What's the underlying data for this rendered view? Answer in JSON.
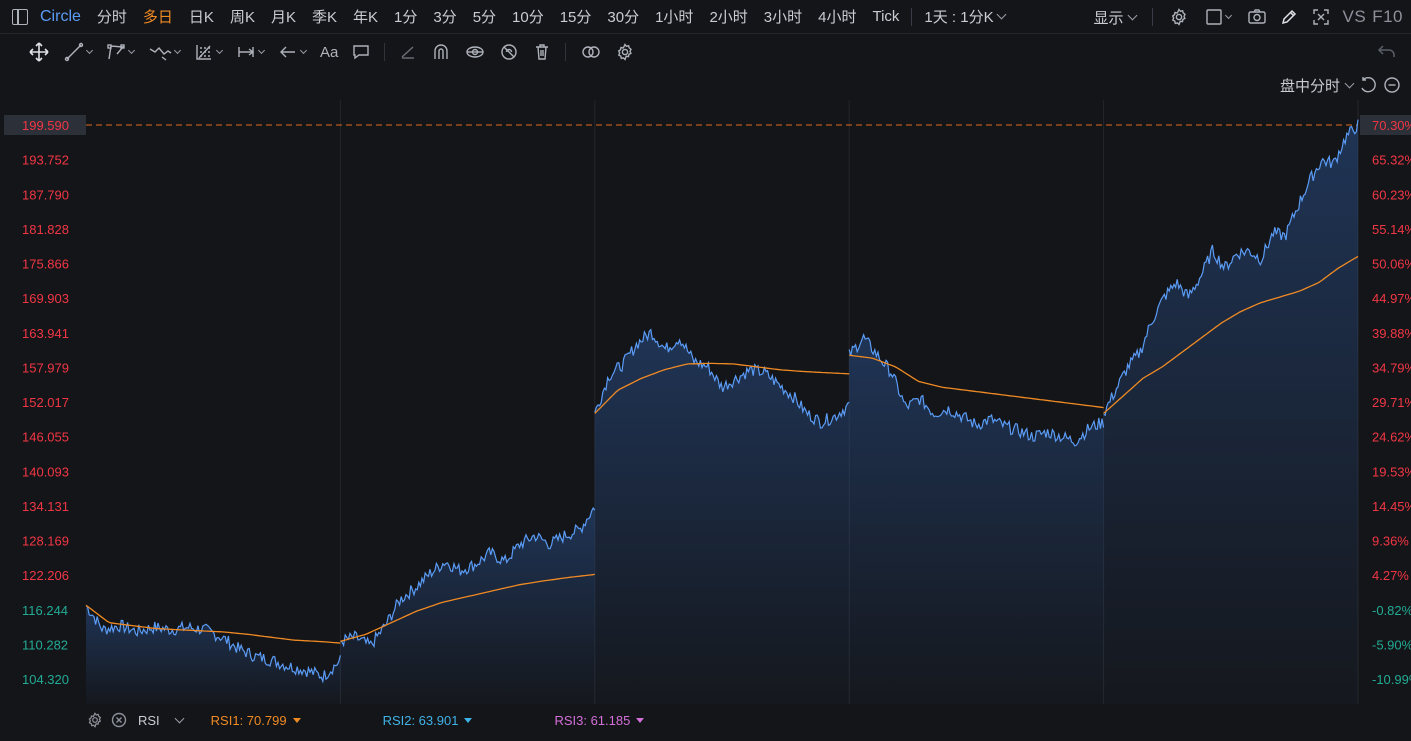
{
  "header": {
    "symbol": "Circle",
    "periods": [
      {
        "label": "分时",
        "active": false
      },
      {
        "label": "多日",
        "active": true
      },
      {
        "label": "日K",
        "active": false
      },
      {
        "label": "周K",
        "active": false
      },
      {
        "label": "月K",
        "active": false
      },
      {
        "label": "季K",
        "active": false
      },
      {
        "label": "年K",
        "active": false
      },
      {
        "label": "1分",
        "active": false
      },
      {
        "label": "3分",
        "active": false
      },
      {
        "label": "5分",
        "active": false
      },
      {
        "label": "10分",
        "active": false
      },
      {
        "label": "15分",
        "active": false
      },
      {
        "label": "30分",
        "active": false
      },
      {
        "label": "1小时",
        "active": false
      },
      {
        "label": "2小时",
        "active": false
      },
      {
        "label": "3小时",
        "active": false
      },
      {
        "label": "4小时",
        "active": false
      },
      {
        "label": "Tick",
        "active": false
      }
    ],
    "range_select": "1天 : 1分K",
    "display_label": "显示",
    "vs_label": "VS",
    "f10_label": "F10"
  },
  "drawing_tools": [
    "move-icon",
    "line-icon",
    "polyline-icon",
    "wave-icon",
    "fib-icon",
    "measure-icon",
    "arrow-icon",
    "text-icon",
    "note-icon",
    "pen-icon",
    "magnet-icon",
    "hide-icon",
    "lock-icon",
    "trash-icon",
    "link-icon",
    "settings-icon"
  ],
  "chart_header": {
    "mode_label": "盘中分时"
  },
  "chart_data": {
    "type": "line",
    "title": "",
    "y_left_ticks": [
      "199.590",
      "193.752",
      "187.790",
      "181.828",
      "175.866",
      "169.903",
      "163.941",
      "157.979",
      "152.017",
      "146.055",
      "140.093",
      "134.131",
      "128.169",
      "122.206",
      "116.244",
      "110.282",
      "104.320"
    ],
    "y_right_ticks": [
      "70.30%",
      "65.32%",
      "60.23%",
      "55.14%",
      "50.06%",
      "44.97%",
      "39.88%",
      "34.79%",
      "29.71%",
      "24.62%",
      "19.53%",
      "14.45%",
      "9.36%",
      "4.27%",
      "-0.82%",
      "-5.90%",
      "-10.99%"
    ],
    "ylim": [
      104.32,
      199.59
    ],
    "reference_price": 117.2,
    "current_price": 199.59,
    "days": 5,
    "series": [
      {
        "name": "price",
        "color": "#5b9cf6",
        "days": [
          [
            117.0,
            112.8,
            113.5,
            112.5,
            113.2,
            112.8,
            113.2,
            112.8,
            111.5,
            109.5,
            108.2,
            107.5,
            106.5,
            105.8,
            104.8,
            107.5
          ],
          [
            110.8,
            111.5,
            110.0,
            113.5,
            118.0,
            120.0,
            122.5,
            124.5,
            123.0,
            124.0,
            126.0,
            124.5,
            127.5,
            129.0,
            127.5,
            129.0,
            130.0,
            134.0
          ],
          [
            150.0,
            156.5,
            158.5,
            162.0,
            164.0,
            161.0,
            163.0,
            159.0,
            158.0,
            154.5,
            156.0,
            157.5,
            157.0,
            155.0,
            153.0,
            150.0,
            148.5,
            149.5,
            151.5
          ],
          [
            160.0,
            163.0,
            160.0,
            157.0,
            151.0,
            152.5,
            150.0,
            150.8,
            149.5,
            148.0,
            149.0,
            147.8,
            147.0,
            146.0,
            146.8,
            146.0,
            145.2,
            147.5,
            148.5
          ],
          [
            150.0,
            154.0,
            158.0,
            160.5,
            166.0,
            170.0,
            172.5,
            170.0,
            173.5,
            178.0,
            175.0,
            177.5,
            178.0,
            176.5,
            181.0,
            180.5,
            185.5,
            190.0,
            193.5,
            193.0,
            197.5,
            199.6
          ]
        ]
      },
      {
        "name": "avg",
        "color": "#f08a24",
        "days": [
          [
            117.0,
            114.0,
            113.5,
            113.0,
            112.8,
            112.6,
            112.4,
            112.0,
            111.5,
            111.0,
            110.8,
            110.5
          ],
          [
            110.8,
            112.0,
            114.0,
            116.0,
            117.5,
            118.5,
            119.5,
            120.5,
            121.2,
            121.8,
            122.3
          ],
          [
            150.0,
            154.0,
            156.0,
            157.5,
            158.5,
            158.6,
            158.5,
            158.0,
            157.5,
            157.2,
            157.0,
            156.8
          ],
          [
            160.0,
            159.5,
            158.0,
            155.5,
            154.5,
            154.0,
            153.5,
            153.0,
            152.5,
            152.0,
            151.5,
            151.0
          ],
          [
            150.0,
            153.0,
            156.0,
            158.0,
            160.5,
            163.0,
            165.5,
            167.5,
            169.0,
            170.0,
            171.0,
            172.5,
            175.0,
            177.0
          ]
        ]
      }
    ],
    "colors": {
      "background": "#141518",
      "grid": "#24262c",
      "up": "#f23645",
      "down": "#22ab94",
      "highlight_bg": "#2c3039",
      "ref_line": "#e06c1f"
    }
  },
  "indicator": {
    "name": "RSI",
    "values": [
      {
        "label": "RSI1: 70.799",
        "color": "#f08a24"
      },
      {
        "label": "RSI2: 63.901",
        "color": "#3fb3e8"
      },
      {
        "label": "RSI3: 61.185",
        "color": "#d46fd9"
      }
    ]
  }
}
